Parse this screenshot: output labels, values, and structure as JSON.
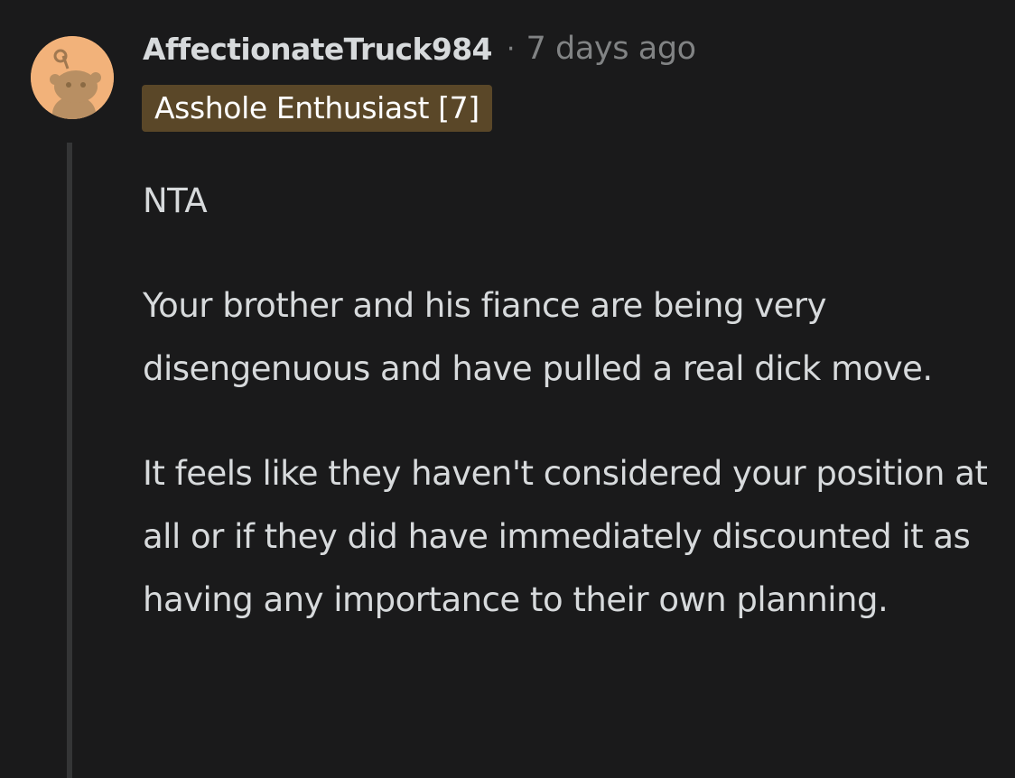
{
  "comment": {
    "avatar_icon": "reddit-snoo-avatar-icon",
    "username": "AffectionateTruck984",
    "separator": "·",
    "timestamp": "7 days ago",
    "flair": "Asshole Enthusiast [7]",
    "paragraphs": [
      "NTA",
      "Your brother and his fiance are being very disengenuous and have pulled a real dick move.",
      "It feels like they haven't considered your position at all or if they did have immediately discounted it as having any importance to their own planning."
    ]
  },
  "colors": {
    "background": "#1a1a1b",
    "text": "#d7dadc",
    "muted": "#818384",
    "flair_bg": "#5a4728",
    "avatar_bg": "#f2b27a",
    "thread_line": "#343536"
  }
}
